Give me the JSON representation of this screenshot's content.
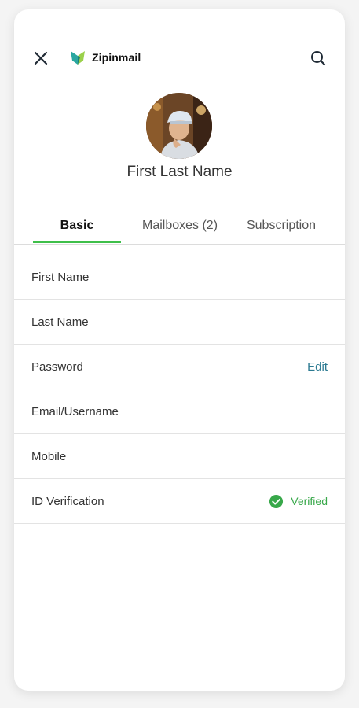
{
  "header": {
    "close_icon": "close-icon",
    "brand_name": "Zipinmail",
    "search_icon": "search-icon"
  },
  "profile": {
    "name": "First Last Name"
  },
  "tabs": [
    {
      "label": "Basic",
      "active": true
    },
    {
      "label": "Mailboxes (2)",
      "active": false
    },
    {
      "label": "Subscription",
      "active": false
    }
  ],
  "fields": {
    "first_name": {
      "label": "First Name"
    },
    "last_name": {
      "label": "Last Name"
    },
    "password": {
      "label": "Password",
      "action": "Edit"
    },
    "email": {
      "label": "Email/Username"
    },
    "mobile": {
      "label": "Mobile"
    },
    "id_verification": {
      "label": "ID Verification",
      "status": "Verified"
    }
  },
  "colors": {
    "accent_green": "#3ebf4a",
    "link_teal": "#2b7a91",
    "verified_green": "#38a84a"
  }
}
